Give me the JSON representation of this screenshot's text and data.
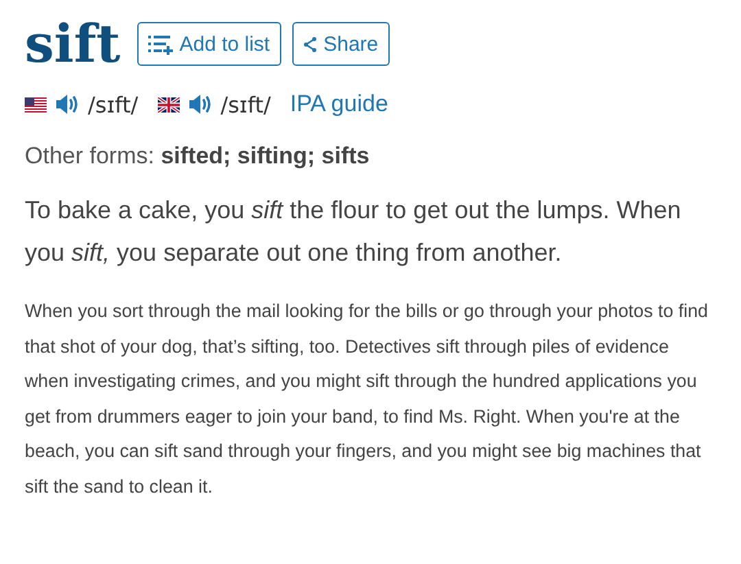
{
  "headword": "sift",
  "actions": [
    {
      "kind": "add",
      "label": "Add to list"
    },
    {
      "kind": "share",
      "label": "Share"
    }
  ],
  "pronunciations": [
    {
      "kind": "us",
      "ipa": "/sɪft/"
    },
    {
      "kind": "uk",
      "ipa": "/sɪft/"
    }
  ],
  "ipa_guide": "IPA guide",
  "other_forms": "Other forms: **sifted; sifting; sifts**",
  "short_definition": "To bake a cake, you *sift* the flour to get out the lumps. When you *sift,* you separate out one thing from another.",
  "long_definition": "When you sort through the mail looking for the bills or go through your photos to find that shot of your dog, that’s sifting, too. Detectives sift through piles of evidence when investigating crimes, and you might sift through the hundred applications you get from drummers eager to join your band, to find Ms. Right. When you're at the beach, you can sift sand through your fingers, and you might see big machines that sift the sand to clean it."
}
